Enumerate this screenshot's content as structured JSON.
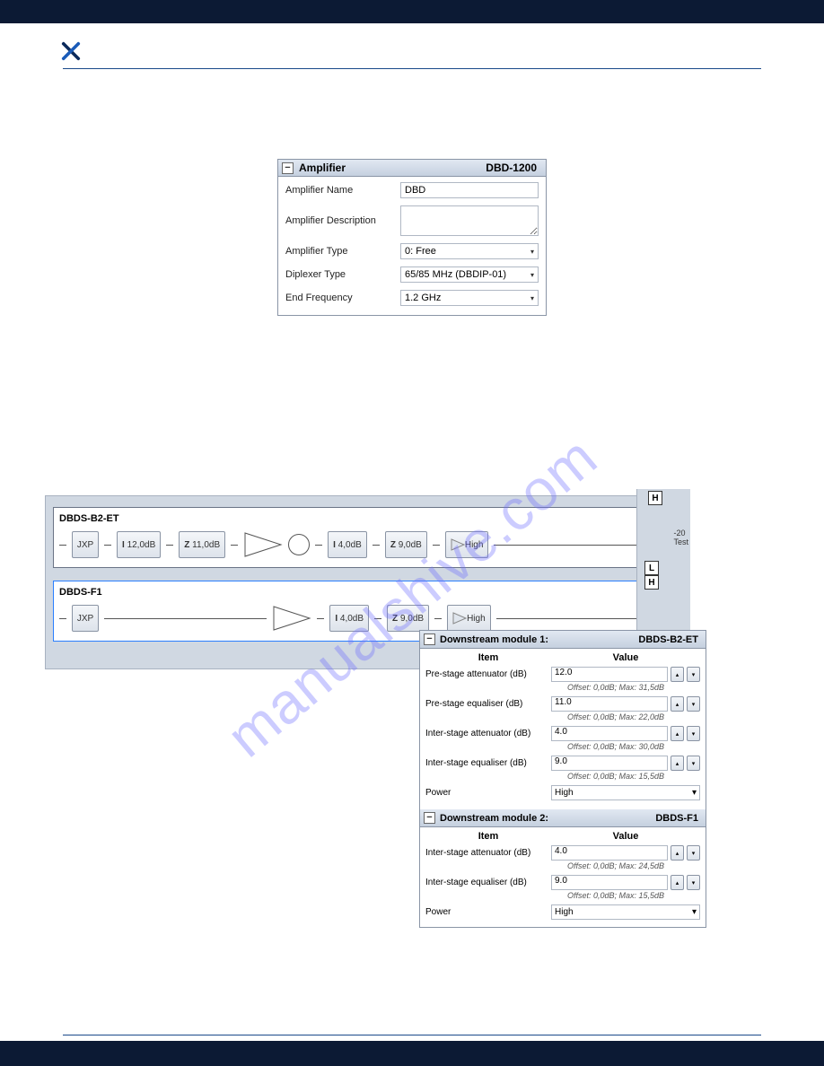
{
  "watermark": "manualshive.com",
  "amplifier": {
    "header_title": "Amplifier",
    "header_right": "DBD-1200",
    "collapse_glyph": "−",
    "fields": {
      "name_label": "Amplifier Name",
      "name_value": "DBD",
      "desc_label": "Amplifier Description",
      "desc_value": "",
      "type_label": "Amplifier Type",
      "type_value": "0: Free",
      "diplexer_label": "Diplexer Type",
      "diplexer_value": "65/85 MHz (DBDIP-01)",
      "endfreq_label": "End Frequency",
      "endfreq_value": "1.2 GHz"
    }
  },
  "diagram": {
    "module1": {
      "title": "DBDS-B2-ET",
      "jxp": "JXP",
      "att1": "12,0dB",
      "eq1": "11,0dB",
      "att2": "4,0dB",
      "eq2": "9,0dB",
      "power": "High",
      "i_glyph": "I",
      "z_glyph": "Z"
    },
    "module2": {
      "title": "DBDS-F1",
      "jxp": "JXP",
      "att2": "4,0dB",
      "eq2": "9,0dB",
      "power": "High",
      "i_glyph": "I",
      "z_glyph": "Z"
    },
    "side": {
      "h": "H",
      "l": "L",
      "minus20": "-20",
      "test": "Test"
    }
  },
  "downstream1": {
    "collapse_glyph": "−",
    "title": "Downstream module 1:",
    "title_right": "DBDS-B2-ET",
    "col_item": "Item",
    "col_value": "Value",
    "rows": {
      "pre_att_label": "Pre-stage attenuator (dB)",
      "pre_att_value": "12.0",
      "pre_att_hint": "Offset: 0,0dB; Max: 31,5dB",
      "pre_eq_label": "Pre-stage equaliser (dB)",
      "pre_eq_value": "11.0",
      "pre_eq_hint": "Offset: 0,0dB; Max: 22,0dB",
      "int_att_label": "Inter-stage attenuator (dB)",
      "int_att_value": "4.0",
      "int_att_hint": "Offset: 0,0dB; Max: 30,0dB",
      "int_eq_label": "Inter-stage equaliser (dB)",
      "int_eq_value": "9.0",
      "int_eq_hint": "Offset: 0,0dB; Max: 15,5dB",
      "power_label": "Power",
      "power_value": "High"
    }
  },
  "downstream2": {
    "collapse_glyph": "−",
    "title": "Downstream module 2:",
    "title_right": "DBDS-F1",
    "col_item": "Item",
    "col_value": "Value",
    "rows": {
      "int_att_label": "Inter-stage attenuator (dB)",
      "int_att_value": "4.0",
      "int_att_hint": "Offset: 0,0dB; Max: 24,5dB",
      "int_eq_label": "Inter-stage equaliser (dB)",
      "int_eq_value": "9.0",
      "int_eq_hint": "Offset: 0,0dB; Max: 15,5dB",
      "power_label": "Power",
      "power_value": "High"
    }
  },
  "glyphs": {
    "up": "▴",
    "down": "▾",
    "dropdown": "▾"
  }
}
